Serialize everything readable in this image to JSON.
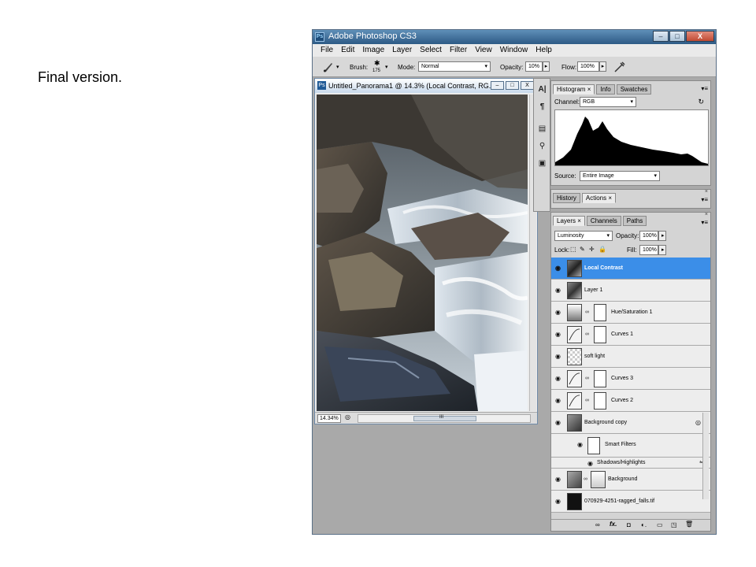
{
  "slide": {
    "caption": "Final version."
  },
  "app": {
    "title": "Adobe Photoshop CS3",
    "logo": "Ps",
    "window_buttons": {
      "minimize": "–",
      "maximize": "□",
      "close": "X"
    }
  },
  "menu": [
    "File",
    "Edit",
    "Image",
    "Layer",
    "Select",
    "Filter",
    "View",
    "Window",
    "Help"
  ],
  "options_bar": {
    "brush_label": "Brush:",
    "brush_size": "175",
    "mode_label": "Mode:",
    "mode_value": "Normal",
    "opacity_label": "Opacity:",
    "opacity_value": "10%",
    "flow_label": "Flow:",
    "flow_value": "100%"
  },
  "document": {
    "title": "Untitled_Panorama1 @ 14.3% (Local Contrast, RG...",
    "zoom": "14.34%",
    "scroll_marker": "III"
  },
  "histogram_panel": {
    "tabs": [
      "Histogram",
      "Info",
      "Swatches"
    ],
    "tab_close": "×",
    "channel_label": "Channel:",
    "channel_value": "RGB",
    "source_label": "Source:",
    "source_value": "Entire Image"
  },
  "history_panel": {
    "tabs": [
      "History",
      "Actions"
    ],
    "tab_close": "×"
  },
  "layers_panel": {
    "tabs": [
      "Layers",
      "Channels",
      "Paths"
    ],
    "tab_close": "×",
    "blend_mode": "Luminosity",
    "opacity_label": "Opacity:",
    "opacity_value": "100%",
    "lock_label": "Lock:",
    "fill_label": "Fill:",
    "fill_value": "100%",
    "layers": [
      {
        "name": "Local Contrast",
        "selected": true,
        "type": "pixel"
      },
      {
        "name": "Layer 1",
        "selected": false,
        "type": "pixel"
      },
      {
        "name": "Hue/Saturation 1",
        "selected": false,
        "type": "adjustment"
      },
      {
        "name": "Curves 1",
        "selected": false,
        "type": "adjustment"
      },
      {
        "name": "soft light",
        "selected": false,
        "type": "transparent"
      },
      {
        "name": "Curves 3",
        "selected": false,
        "type": "adjustment"
      },
      {
        "name": "Curves 2",
        "selected": false,
        "type": "adjustment"
      },
      {
        "name": "Background copy",
        "selected": false,
        "type": "smart"
      },
      {
        "name": "Smart Filters",
        "selected": false,
        "type": "filter-group"
      },
      {
        "name": "Shadows/Highlights",
        "selected": false,
        "type": "filter"
      },
      {
        "name": "Background",
        "selected": false,
        "type": "masked"
      },
      {
        "name": "070929-4251-ragged_falls.tif",
        "selected": false,
        "type": "pixel-dark"
      }
    ],
    "bottom_icons": [
      "link-icon",
      "fx-icon",
      "mask-icon",
      "adjustment-icon",
      "group-icon",
      "new-layer-icon",
      "trash-icon"
    ],
    "bottom_glyphs": {
      "link": "∞",
      "fx": "fx.",
      "mask": "◘",
      "adjustment": "◐.",
      "group": "▭",
      "new_layer": "◳",
      "trash": "🗑"
    }
  },
  "colors": {
    "selection": "#3b8ee8",
    "workspace": "#a9a9a9",
    "titlebar": "#2d5a85"
  }
}
